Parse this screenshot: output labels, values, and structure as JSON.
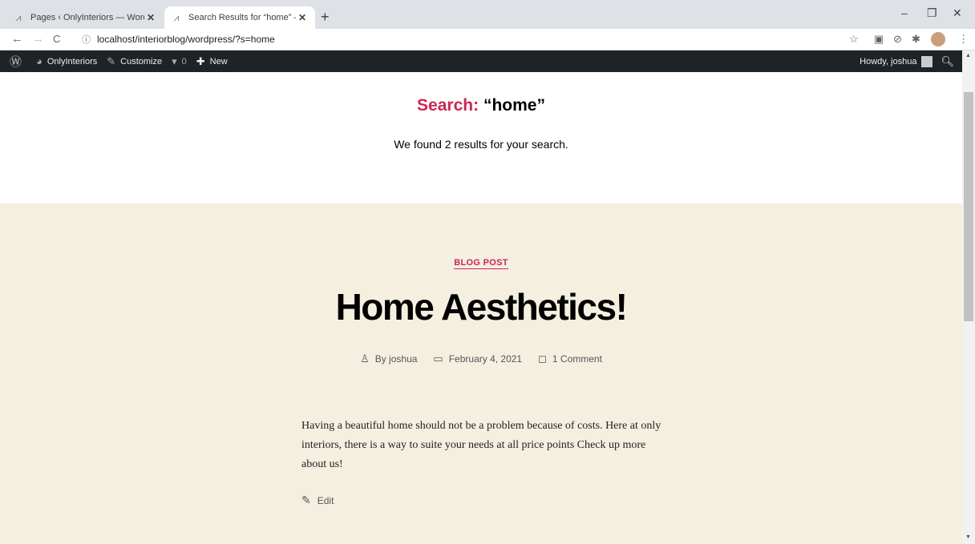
{
  "browser": {
    "tabs": [
      {
        "title": "Pages ‹ OnlyInteriors — WordPre",
        "close": "✕"
      },
      {
        "title": "Search Results for “home” – Only",
        "close": "✕"
      }
    ],
    "new_tab": "+",
    "window_controls": {
      "minimize": "–",
      "restore": "❐",
      "close": "✕"
    },
    "nav": {
      "back": "←",
      "forward": "→",
      "reload": "C"
    },
    "url": "localhost/interiorblog/wordpress/?s=home"
  },
  "admin_bar": {
    "site_name": "OnlyInteriors",
    "customize": "Customize",
    "comments_count": "0",
    "new": "New",
    "howdy": "Howdy, joshua"
  },
  "search": {
    "label": "Search:",
    "query": "“home”",
    "description": "We found 2 results for your search."
  },
  "post": {
    "category": "BLOG POST",
    "title": "Home Aesthetics!",
    "author": "By joshua",
    "date": "February 4, 2021",
    "comments": "1 Comment",
    "excerpt": "Having a beautiful home should not be a problem because of costs. Here at only interiors, there is a way to suite your needs at all price points Check up more about us!",
    "edit": "Edit"
  },
  "colors": {
    "accent": "#cd2653",
    "post_background": "#f5efe0",
    "admin_bar": "#1d2327"
  }
}
